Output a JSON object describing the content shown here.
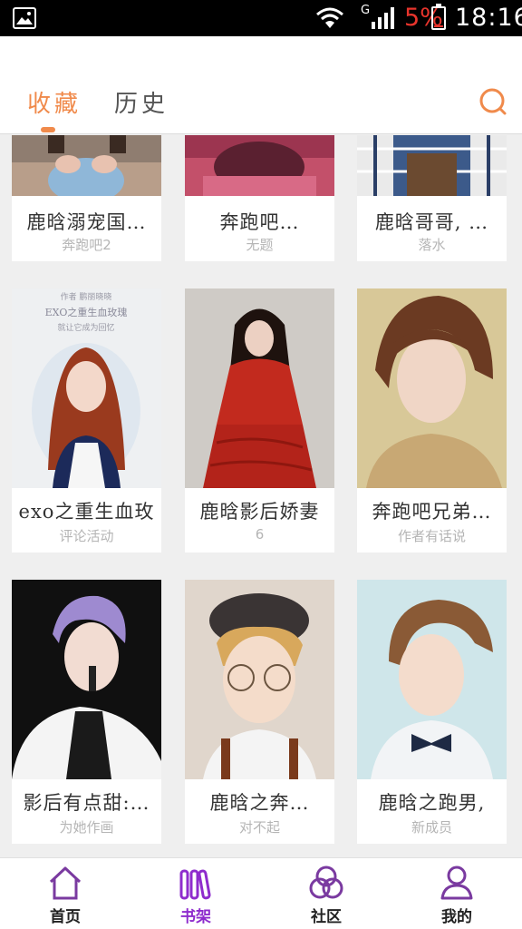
{
  "status_bar": {
    "network_type": "G",
    "battery_percent": "5%",
    "time": "18:16",
    "battery_color": "#e8342c"
  },
  "header": {
    "tabs": [
      {
        "label": "收藏",
        "active": true
      },
      {
        "label": "历史",
        "active": false
      }
    ],
    "accent_color": "#f08a4b"
  },
  "books": [
    {
      "title": "鹿晗溺宠国…",
      "subtitle": "奔跑吧2"
    },
    {
      "title": "奔跑吧…",
      "subtitle": "无题"
    },
    {
      "title": "鹿晗哥哥, …",
      "subtitle": "落水"
    },
    {
      "title": "exo之重生血玫",
      "subtitle": "评论活动",
      "cover_text": [
        "作者 鹏丽晓晓",
        "EXO之重生血玫瑰",
        "就让它成为回忆"
      ]
    },
    {
      "title": "鹿晗影后娇妻",
      "subtitle": "6"
    },
    {
      "title": "奔跑吧兄弟…",
      "subtitle": "作者有话说"
    },
    {
      "title": "影后有点甜:…",
      "subtitle": "为她作画"
    },
    {
      "title": "鹿晗之奔…",
      "subtitle": "对不起"
    },
    {
      "title": "鹿晗之跑男,",
      "subtitle": "新成员"
    }
  ],
  "bottom_nav": {
    "items": [
      {
        "label": "首页",
        "icon": "home-icon",
        "active": false
      },
      {
        "label": "书架",
        "icon": "bookshelf-icon",
        "active": true
      },
      {
        "label": "社区",
        "icon": "community-icon",
        "active": false
      },
      {
        "label": "我的",
        "icon": "profile-icon",
        "active": false
      }
    ],
    "active_color": "#8e2ccd",
    "icon_color": "#7a3aa0"
  }
}
